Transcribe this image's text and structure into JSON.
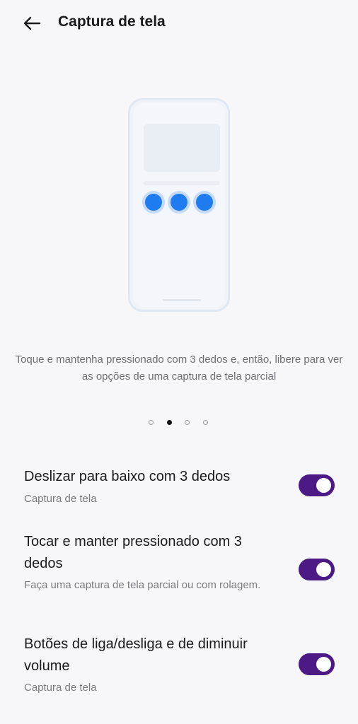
{
  "header": {
    "title": "Captura de tela",
    "back_icon": "arrow-left-icon"
  },
  "illustration": {
    "icon": "three-finger-touch-phone-illustration",
    "accent_color": "#1e7bf0"
  },
  "description": "Toque e mantenha pressionado com 3 dedos e, então, libere para ver as opções de uma captura de tela parcial",
  "pager": {
    "count": 4,
    "active_index": 1
  },
  "settings": [
    {
      "title": "Deslizar para baixo com 3 dedos",
      "subtitle": "Captura de tela",
      "enabled": true
    },
    {
      "title": "Tocar e manter pressionado com 3 dedos",
      "subtitle": "Faça uma captura de tela parcial ou com rolagem.",
      "enabled": true
    },
    {
      "title": "Botões de liga/desliga e de diminuir volume",
      "subtitle": "Captura de tela",
      "enabled": true
    }
  ],
  "colors": {
    "toggle_on": "#4b1a86",
    "background": "#f7f7f9"
  }
}
